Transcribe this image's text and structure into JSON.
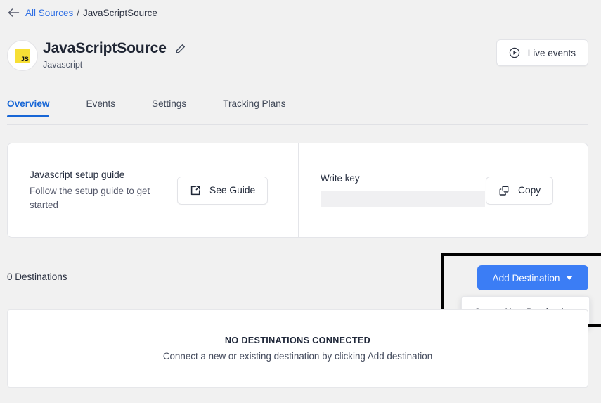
{
  "breadcrumb": {
    "back_icon": "arrow-left-icon",
    "root_label": "All Sources",
    "separator": "/",
    "current_label": "JavaScriptSource"
  },
  "header": {
    "avatar_label": "JS",
    "title": "JavaScriptSource",
    "subtitle": "Javascript",
    "edit_icon": "pencil-icon",
    "live_events": {
      "label": "Live events",
      "icon": "play-circle-icon"
    }
  },
  "tabs": [
    {
      "label": "Overview",
      "active": true
    },
    {
      "label": "Events",
      "active": false
    },
    {
      "label": "Settings",
      "active": false
    },
    {
      "label": "Tracking Plans",
      "active": false
    }
  ],
  "setup_card": {
    "title": "Javascript setup guide",
    "description": "Follow the setup guide to get started",
    "button_label": "See Guide",
    "button_icon": "external-link-icon"
  },
  "write_key_card": {
    "label": "Write key",
    "value": "",
    "button_label": "Copy",
    "button_icon": "copy-icon"
  },
  "destinations": {
    "count_label": "0 Destinations",
    "add_button_label": "Add Destination",
    "add_button_icon": "chevron-down-icon",
    "dropdown_items": [
      {
        "label": "Create New Destination"
      }
    ],
    "empty_title": "NO DESTINATIONS CONNECTED",
    "empty_subtitle": "Connect a new or existing destination by clicking Add destination"
  },
  "colors": {
    "accent_blue": "#3b7df5",
    "link_blue": "#2f6fe4",
    "tab_active": "#1766d6",
    "js_yellow": "#f7df35",
    "page_bg": "#f1f1f1",
    "highlight_outline": "#000000"
  }
}
